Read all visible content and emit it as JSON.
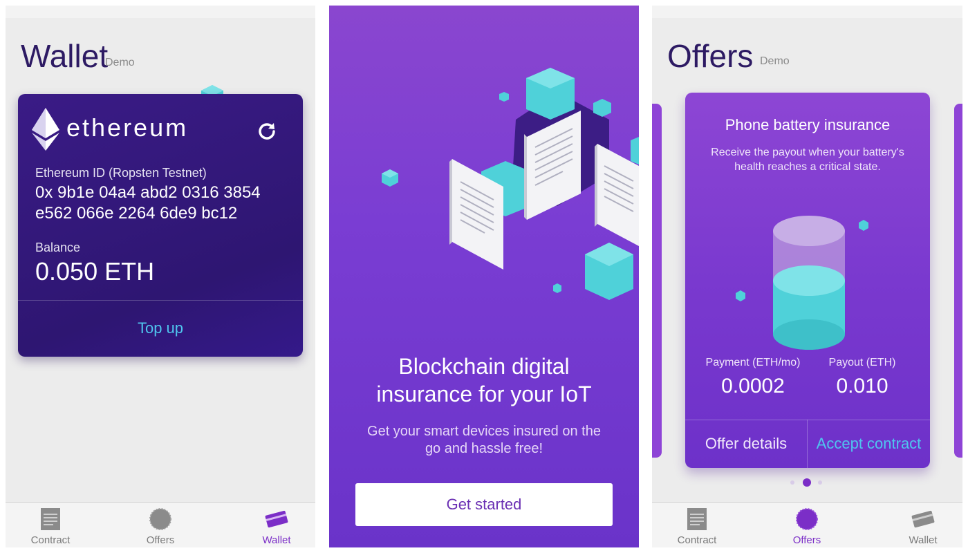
{
  "wallet_screen": {
    "title": "Wallet",
    "subtitle": "Demo",
    "card": {
      "brand": "ethereum",
      "id_label": "Ethereum ID (Ropsten Testnet)",
      "id_line1": "0x 9b1e 04a4 abd2 0316 3854",
      "id_line2": "e562 066e 2264 6de9 bc12",
      "balance_label": "Balance",
      "balance": "0.050 ETH",
      "topup_label": "Top up"
    },
    "nav": {
      "contract": "Contract",
      "offers": "Offers",
      "wallet": "Wallet",
      "active": "wallet"
    }
  },
  "onboarding_screen": {
    "headline_line1": "Blockchain digital",
    "headline_line2": "insurance for your IoT",
    "subtext_line1": "Get your smart devices insured on the",
    "subtext_line2": "go and hassle free!",
    "button_label": "Get started"
  },
  "offers_screen": {
    "title": "Offers",
    "subtitle": "Demo",
    "card": {
      "title": "Phone battery insurance",
      "desc_line1": "Receive the payout when your battery's",
      "desc_line2": "health reaches a critical state.",
      "payment_label": "Payment (ETH/mo)",
      "payment_value": "0.0002",
      "payout_label": "Payout (ETH)",
      "payout_value": "0.010",
      "details_label": "Offer details",
      "accept_label": "Accept contract"
    },
    "pager": {
      "count": 3,
      "active_index": 1
    },
    "nav": {
      "contract": "Contract",
      "offers": "Offers",
      "wallet": "Wallet",
      "active": "offers"
    }
  },
  "colors": {
    "accent_purple": "#7b2ec7",
    "link_cyan": "#4fc5ee",
    "wallet_card": "#2e1672",
    "title_dark": "#2d1a63",
    "cube_cyan": "#4fd1d9"
  },
  "icons": [
    "eth-diamond-icon",
    "refresh-icon",
    "contract-icon",
    "offers-badge-icon",
    "wallet-card-icon",
    "battery-cylinder-icon"
  ]
}
